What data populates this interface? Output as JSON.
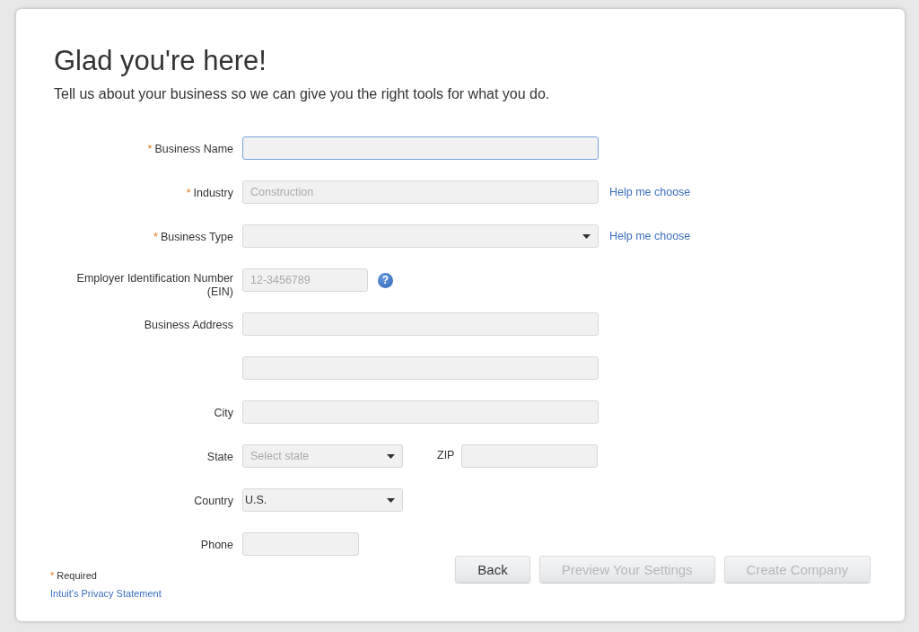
{
  "title": "Glad you're here!",
  "subtitle": "Tell us about your business so we can give you the right tools for what you do.",
  "fields": [
    {
      "label": "Business Name",
      "required_mark": "*",
      "kind": "text",
      "focused": true
    },
    {
      "label": "Industry",
      "required_mark": "*",
      "kind": "text",
      "placeholder": "Construction",
      "focused": false,
      "link": "Help me choose"
    },
    {
      "label": "Business Type",
      "required_mark": "*",
      "kind": "select",
      "focused": false,
      "link": "Help me choose"
    },
    {
      "label": "Employer Identification Number (EIN)",
      "kind": "short-text",
      "placeholder": "12-3456789",
      "focused": false,
      "help_icon": "?"
    },
    {
      "label": "Business Address",
      "kind": "text",
      "focused": false
    },
    {
      "kind": "text",
      "focused": false
    },
    {
      "label": "City",
      "kind": "text",
      "focused": false
    },
    {
      "label": "State",
      "kind": "short-select",
      "placeholder": "Select state",
      "focused": false,
      "extra": {
        "label": "ZIP",
        "kind": "zip"
      }
    },
    {
      "label": "Country",
      "kind": "short-select",
      "value": "U.S.",
      "focused": false
    },
    {
      "label": "Phone",
      "kind": "phone",
      "focused": false
    }
  ],
  "required_note": {
    "mark": "*",
    "text": "Required"
  },
  "privacy_link": "Intuit's Privacy Statement",
  "buttons": [
    {
      "label": "Back",
      "disabled": false
    },
    {
      "label": "Preview Your Settings",
      "disabled": true
    },
    {
      "label": "Create Company",
      "disabled": true
    }
  ]
}
